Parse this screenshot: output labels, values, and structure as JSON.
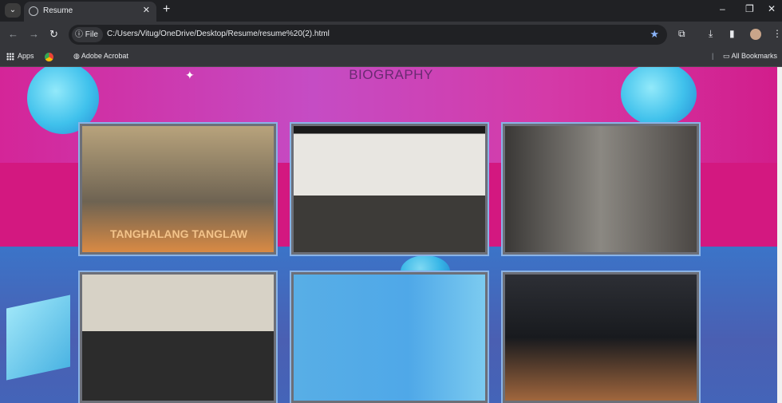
{
  "browser": {
    "tab_title": "Resume",
    "url_chip": "File",
    "url": "C:/Users/Vitug/OneDrive/Desktop/Resume/resume%20(2).html",
    "bookmarks": {
      "apps": "Apps",
      "acrobat": "Adobe Acrobat",
      "all": "All Bookmarks"
    }
  },
  "page": {
    "heading": "BIOGRAPHY",
    "photos": [
      {
        "caption": "TANGHALANG TANGLAW"
      },
      {
        "caption": ""
      },
      {
        "caption": ""
      },
      {
        "caption": ""
      },
      {
        "caption": ""
      },
      {
        "caption": ""
      }
    ]
  }
}
